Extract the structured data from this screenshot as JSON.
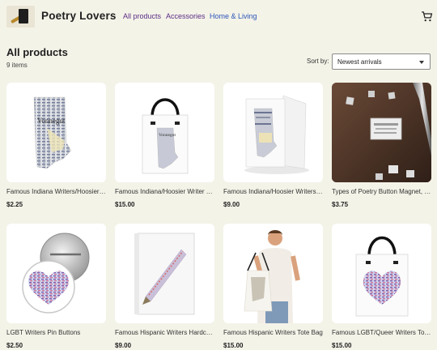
{
  "header": {
    "brand": "Poetry Lovers",
    "nav": [
      "All products",
      "Accessories",
      "Home & Living"
    ]
  },
  "listing": {
    "title": "All products",
    "count": "9 items",
    "sort_label": "Sort by:",
    "sort_value": "Newest arrivals"
  },
  "products": [
    {
      "name": "Famous Indiana Writers/Hoosier Writers Poster",
      "price": "$2.25"
    },
    {
      "name": "Famous Indiana/Hoosier Writer Tote Bag",
      "price": "$15.00"
    },
    {
      "name": "Famous Indiana/Hoosier Writers Journal",
      "price": "$9.00"
    },
    {
      "name": "Types of Poetry Button Magnet, Rectangle",
      "price": "$3.75"
    },
    {
      "name": "LGBT Writers Pin Buttons",
      "price": "$2.50"
    },
    {
      "name": "Famous Hispanic Writers Hardcover Journal",
      "price": "$9.00"
    },
    {
      "name": "Famous Hispanic Writers Tote Bag",
      "price": "$15.00"
    },
    {
      "name": "Famous LGBT/Queer Writers Tote Bag",
      "price": "$15.00"
    }
  ],
  "art_text": {
    "vonnegut": "Vonnegut"
  }
}
